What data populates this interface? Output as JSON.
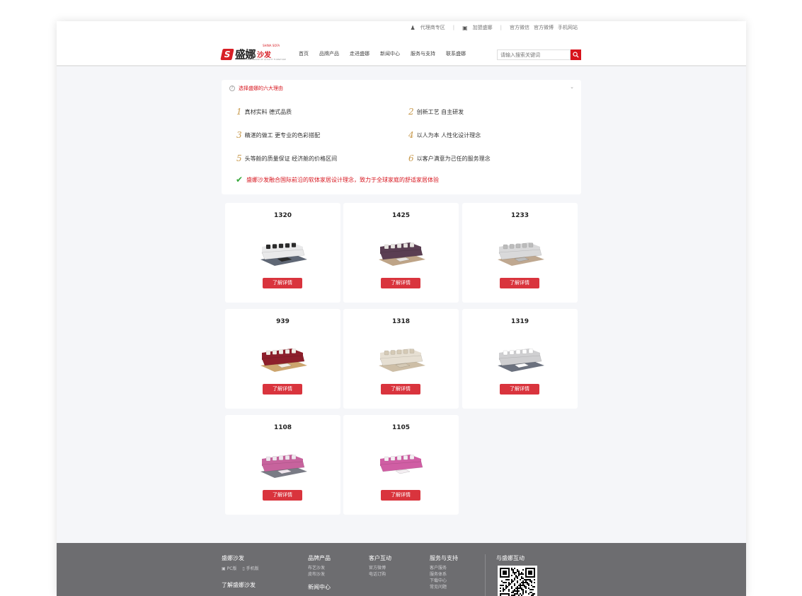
{
  "top_links": {
    "agent": "代理商专区",
    "join": "加盟盛娜",
    "wechat": "官方微信",
    "weibo": "官方微博",
    "mobile": "手机网站"
  },
  "logo": {
    "brand": "盛娜",
    "brand_suffix": "沙发",
    "english": "SHINA SOFA",
    "tagline": "ASIAN LEADING BRAND OF QUALITY FURNITURE"
  },
  "nav": [
    "首页",
    "品牌产品",
    "走进盛娜",
    "新闻中心",
    "服务与支持",
    "联系盛娜"
  ],
  "search": {
    "placeholder": "请输入搜索关键词"
  },
  "reasons": {
    "title": "选择盛娜的六大理由",
    "items": [
      {
        "num": "1",
        "text": "真材实料 德式品质"
      },
      {
        "num": "2",
        "text": "创新工艺 自主研发"
      },
      {
        "num": "3",
        "text": "精湛的做工 更专业的色彩搭配"
      },
      {
        "num": "4",
        "text": "以人为本 人性化设计理念"
      },
      {
        "num": "5",
        "text": "头等舱的质量保证 经济舱的价格区间"
      },
      {
        "num": "6",
        "text": "以客户满意为己任的服务理念"
      }
    ],
    "mission": "盛娜沙发融合国际前沿的软体家居设计理念，致力于全球家庭的舒适家居体验"
  },
  "products": [
    {
      "model": "1320",
      "color": "#e9e9ea",
      "accent": "#2b2b2b",
      "rug": "#4e5766"
    },
    {
      "model": "1425",
      "color": "#5a3e52",
      "accent": "#e8e4e0",
      "rug": "#b79a7a"
    },
    {
      "model": "1233",
      "color": "#d9d9da",
      "accent": "#bcbcbc",
      "rug": "#b89f84"
    },
    {
      "model": "939",
      "color": "#8d1f2b",
      "accent": "#f1ede6",
      "rug": "#c69b5e"
    },
    {
      "model": "1318",
      "color": "#e6dfd2",
      "accent": "#d5cab6",
      "rug": "#c8b79c"
    },
    {
      "model": "1319",
      "color": "#cfcfd1",
      "accent": "#ffffff",
      "rug": "#5b6270"
    },
    {
      "model": "1108",
      "color": "#c7639d",
      "accent": "#f0e6ee",
      "rug": "#6a6d78"
    },
    {
      "model": "1105",
      "color": "#d05ea4",
      "accent": "#f4eef2",
      "rug": "#ffffff"
    }
  ],
  "more_label": "了解详情",
  "footer": {
    "col1": {
      "title": "盛娜沙发",
      "pc": "PC版",
      "mobile": "手机版",
      "title2": "了解盛娜沙发"
    },
    "col2": {
      "title": "品牌产品",
      "items": [
        "布艺沙发",
        "皮布沙发"
      ],
      "title2": "新闻中心"
    },
    "col3": {
      "title": "客户互动",
      "items": [
        "官方微博",
        "电话订购"
      ]
    },
    "col4": {
      "title": "服务与支持",
      "items": [
        "客户服务",
        "服务体系",
        "下载中心",
        "常见问题"
      ]
    },
    "col5": {
      "title": "与盛娜互动"
    }
  }
}
